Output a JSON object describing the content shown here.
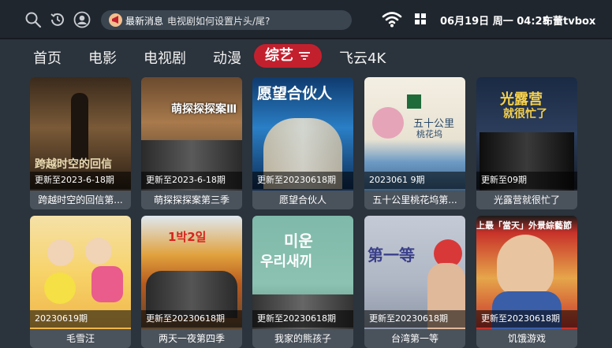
{
  "topbar": {
    "icons": [
      "search-icon",
      "history-icon",
      "user-icon"
    ],
    "news_label": "最新消息",
    "news_text": "电视剧如何设置片头/尾?",
    "clock": "06月19日 周一 04:25",
    "brand": "布蕾tvbox"
  },
  "tabs": [
    {
      "label": "首页"
    },
    {
      "label": "电影"
    },
    {
      "label": "电视剧"
    },
    {
      "label": "动漫"
    },
    {
      "label": "综艺",
      "active": true
    },
    {
      "label": "飞云4K"
    }
  ],
  "cards": [
    {
      "badge": "更新至2023-6-18期",
      "title": "跨越时空的回信第..."
    },
    {
      "badge": "更新至2023-6-18期",
      "title": "萌探探探案第三季"
    },
    {
      "badge": "更新至20230618期",
      "title": "愿望合伙人"
    },
    {
      "badge": "2023061 9期",
      "title": "五十公里桃花坞第..."
    },
    {
      "badge": "更新至09期",
      "title": "光露营就很忙了"
    },
    {
      "badge": "20230619期",
      "title": "毛雪汪"
    },
    {
      "badge": "更新至20230618期",
      "title": "两天一夜第四季"
    },
    {
      "badge": "更新至20230618期",
      "title": "我家的熊孩子"
    },
    {
      "badge": "更新至20230618期",
      "title": "台湾第一等"
    },
    {
      "badge": "更新至20230618期",
      "title": "饥饿游戏"
    }
  ],
  "poster_texts": {
    "p1": "跨越时空的回信",
    "p2": "萌探探探案Ⅲ",
    "p3": "愿望合伙人",
    "p4a": "五十公里",
    "p4b": "桃花坞",
    "p5a": "光露营",
    "p5b": "就很忙了",
    "p7": "1박2일",
    "p8a": "미운",
    "p8b": "우리새끼",
    "p9": "第一等",
    "p10": "上最「當天」外景綜藝節"
  },
  "colors": {
    "accent": "#c3202e",
    "background": "#2b333c",
    "topbar": "#1f262e"
  }
}
